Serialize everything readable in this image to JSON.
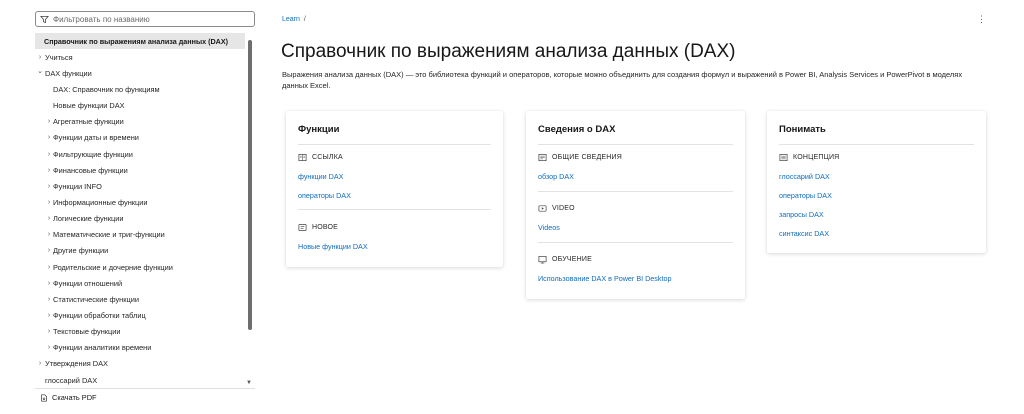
{
  "sidebar": {
    "filter_placeholder": "Фильтровать по названию",
    "items": [
      {
        "label": "Справочник по выражениям анализа данных (DAX)",
        "level": 0,
        "chevron": "",
        "active": true
      },
      {
        "label": "Учиться",
        "level": 0,
        "chevron": "›"
      },
      {
        "label": "DAX функции",
        "level": 0,
        "chevron": "⌄"
      },
      {
        "label": "DAX: Справочник по функциям",
        "level": 1,
        "chevron": ""
      },
      {
        "label": "Новые функции DAX",
        "level": 1,
        "chevron": ""
      },
      {
        "label": "Агрегатные функции",
        "level": 1,
        "chevron": "›"
      },
      {
        "label": "Функции даты и времени",
        "level": 1,
        "chevron": "›"
      },
      {
        "label": "Фильтрующие функции",
        "level": 1,
        "chevron": "›"
      },
      {
        "label": "Финансовые функции",
        "level": 1,
        "chevron": "›"
      },
      {
        "label": "Функции INFO",
        "level": 1,
        "chevron": "›"
      },
      {
        "label": "Информационные функции",
        "level": 1,
        "chevron": "›"
      },
      {
        "label": "Логические функции",
        "level": 1,
        "chevron": "›"
      },
      {
        "label": "Математические и триг-функции",
        "level": 1,
        "chevron": "›"
      },
      {
        "label": "Другие функции",
        "level": 1,
        "chevron": "›"
      },
      {
        "label": "Родительские и дочерние функции",
        "level": 1,
        "chevron": "›"
      },
      {
        "label": "Функции отношений",
        "level": 1,
        "chevron": "›"
      },
      {
        "label": "Статистические функции",
        "level": 1,
        "chevron": "›"
      },
      {
        "label": "Функции обработки таблиц",
        "level": 1,
        "chevron": "›"
      },
      {
        "label": "Текстовые функции",
        "level": 1,
        "chevron": "›"
      },
      {
        "label": "Функции аналитики времени",
        "level": 1,
        "chevron": "›"
      },
      {
        "label": "Утверждения DAX",
        "level": 0,
        "chevron": "›"
      },
      {
        "label": "глоссарий DAX",
        "level": 0,
        "chevron": ""
      }
    ],
    "download_pdf": "Скачать PDF"
  },
  "breadcrumb": {
    "root": "Learn",
    "separator": "/"
  },
  "more_glyph": "⋮",
  "page": {
    "title": "Справочник по выражениям анализа данных (DAX)",
    "description": "Выражения анализа данных (DAX) — это библиотека функций и операторов, которые можно объединить для создания формул и выражений в Power BI, Analysis Services и PowerPivot в моделях данных Excel."
  },
  "cards": [
    {
      "title": "Функции",
      "sections": [
        {
          "icon": "reference-icon",
          "heading": "ССЫЛКА",
          "links": [
            "функции DAX",
            "операторы DAX"
          ]
        },
        {
          "icon": "new-icon",
          "heading": "НОВОЕ",
          "links": [
            "Новые функции DAX"
          ]
        }
      ]
    },
    {
      "title": "Сведения о DAX",
      "sections": [
        {
          "icon": "overview-icon",
          "heading": "ОБЩИЕ СВЕДЕНИЯ",
          "links": [
            "обзор DAX"
          ]
        },
        {
          "icon": "video-icon",
          "heading": "VIDEO",
          "links": [
            "Videos"
          ]
        },
        {
          "icon": "training-icon",
          "heading": "ОБУЧЕНИЕ",
          "links": [
            "Использование DAX в Power BI Desktop"
          ]
        }
      ]
    },
    {
      "title": "Понимать",
      "sections": [
        {
          "icon": "concept-icon",
          "heading": "КОНЦЕПЦИЯ",
          "links": [
            "глоссарий DAX",
            "операторы DAX",
            "запросы DAX",
            "синтаксис DAX"
          ]
        }
      ]
    }
  ],
  "colors": {
    "link": "#0f6cbd",
    "active_bg": "#e6e6e6",
    "text": "#171717"
  }
}
